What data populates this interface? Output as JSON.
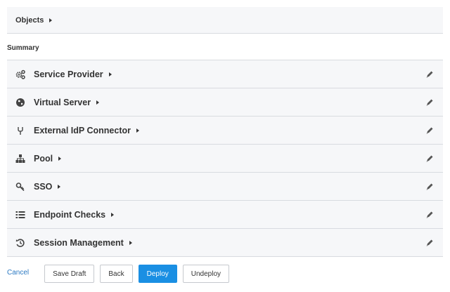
{
  "objects": {
    "label": "Objects"
  },
  "summary": {
    "heading": "Summary",
    "items": [
      {
        "label": "Service Provider",
        "icon": "gears-icon"
      },
      {
        "label": "Virtual Server",
        "icon": "globe-icon"
      },
      {
        "label": "External IdP Connector",
        "icon": "connector-icon"
      },
      {
        "label": "Pool",
        "icon": "sitemap-icon"
      },
      {
        "label": "SSO",
        "icon": "key-icon"
      },
      {
        "label": "Endpoint Checks",
        "icon": "list-icon"
      },
      {
        "label": "Session Management",
        "icon": "history-icon"
      }
    ]
  },
  "footer": {
    "cancel": "Cancel",
    "save_draft": "Save Draft",
    "back": "Back",
    "deploy": "Deploy",
    "undeploy": "Undeploy"
  },
  "colors": {
    "primary": "#1a8fe3",
    "link": "#2b79c2",
    "row_bg": "#f6f7f9",
    "border": "#d8dbe0"
  }
}
